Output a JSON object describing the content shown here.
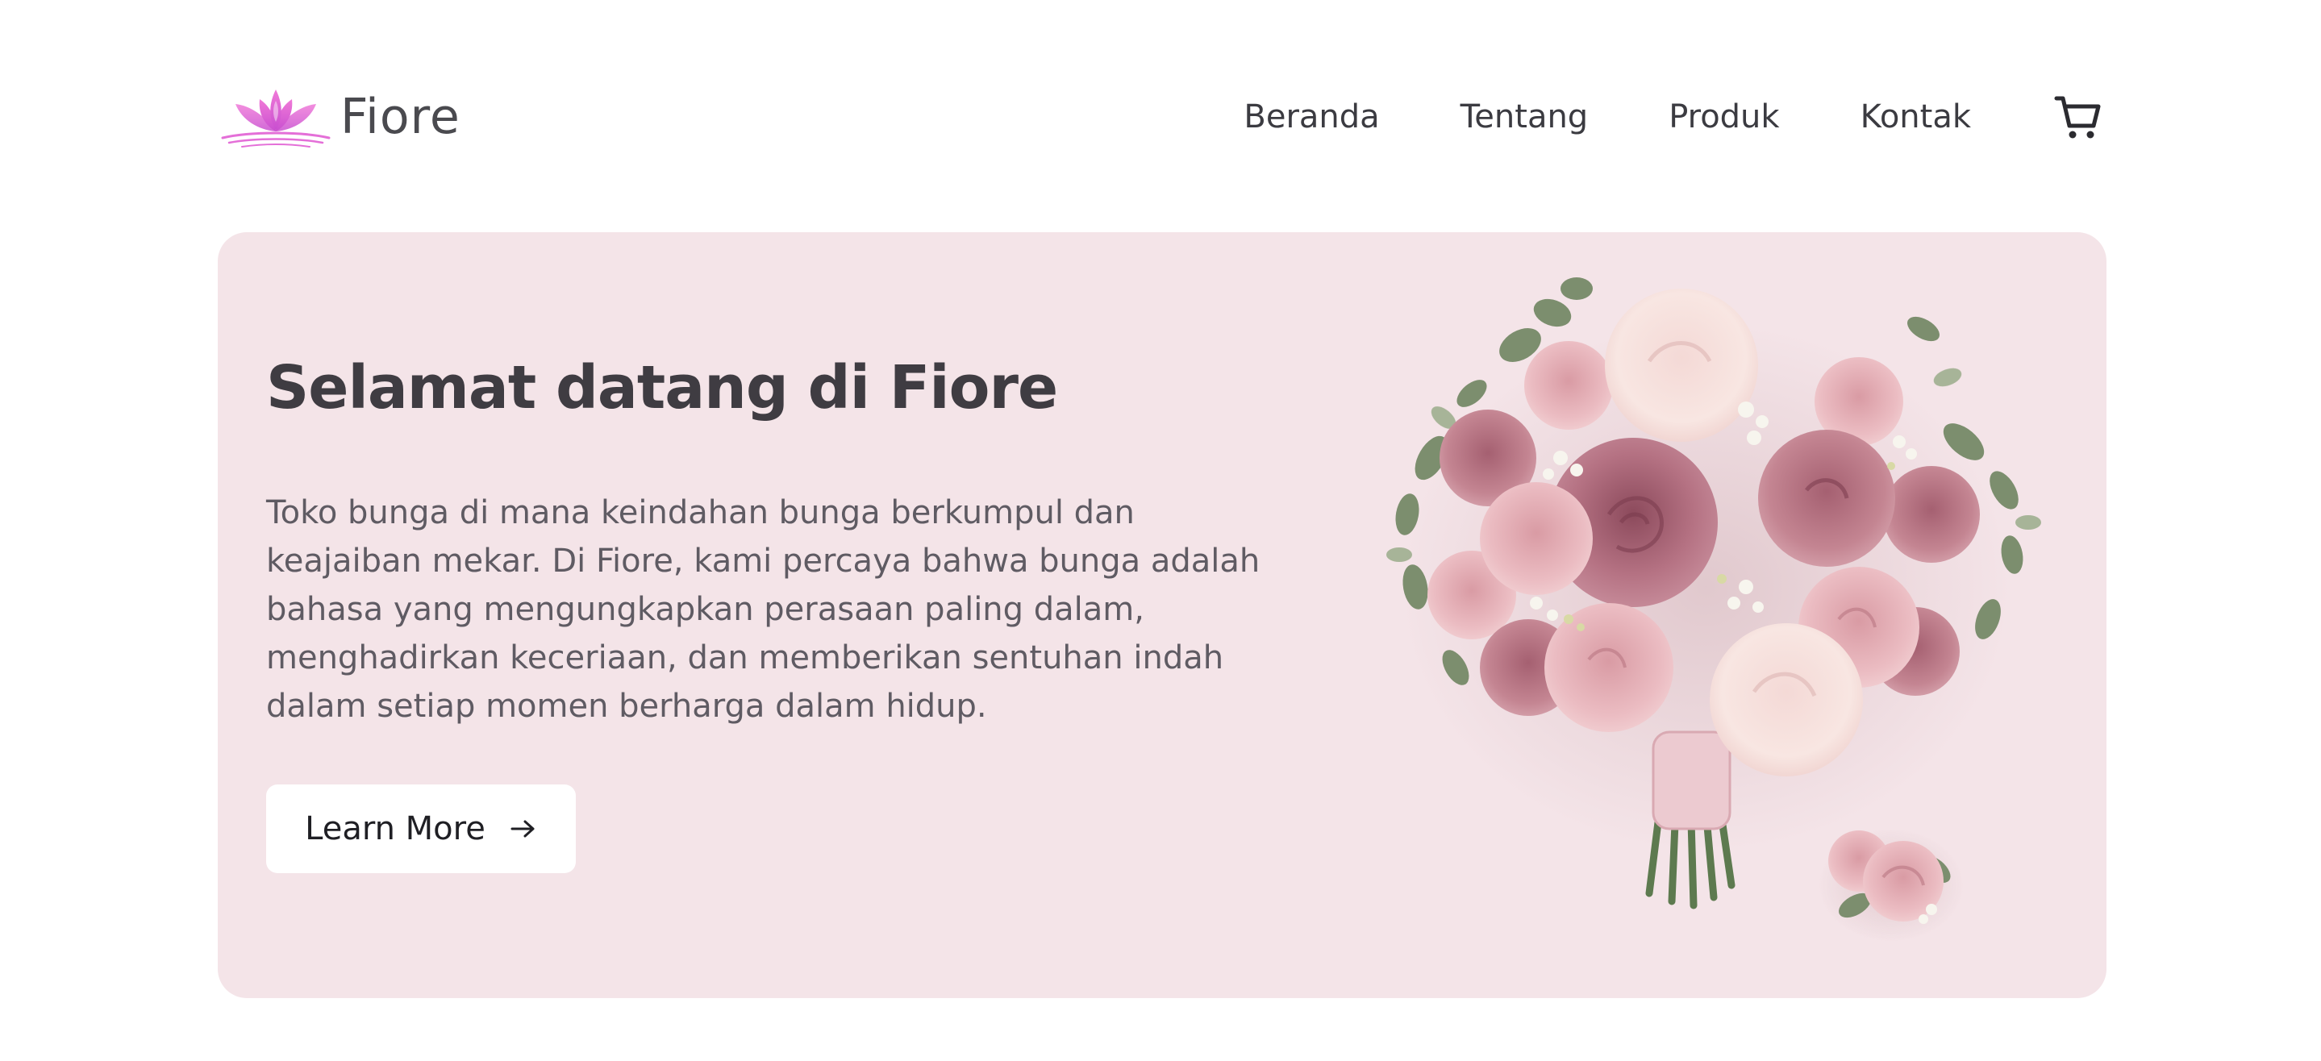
{
  "brand": {
    "name": "Fiore",
    "logo_icon": "lotus-icon",
    "accent_color": "#e46fd8"
  },
  "nav": {
    "items": [
      {
        "label": "Beranda"
      },
      {
        "label": "Tentang"
      },
      {
        "label": "Produk"
      },
      {
        "label": "Kontak"
      }
    ],
    "cart_icon": "shopping-cart-icon"
  },
  "hero": {
    "title": "Selamat datang di Fiore",
    "description": "Toko bunga di mana keindahan bunga berkumpul dan keajaiban mekar. Di Fiore, kami percaya bahwa bunga adalah bahasa yang mengungkapkan perasaan paling dalam, menghadirkan keceriaan, dan memberikan sentuhan indah dalam setiap momen berharga dalam hidup.",
    "cta_label": "Learn More",
    "cta_icon": "arrow-right-icon",
    "background_color": "#f4e4e8",
    "image": "bouquet-image"
  }
}
